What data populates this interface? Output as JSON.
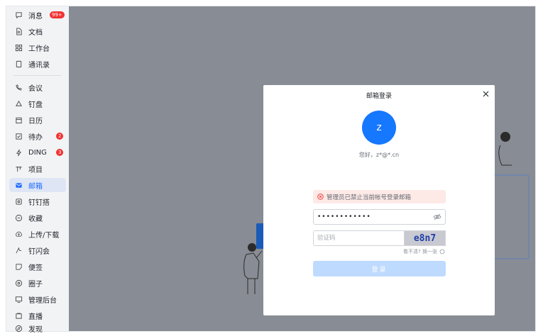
{
  "sidebar": {
    "items": [
      {
        "label": "消息",
        "icon": "chat-bubble-icon",
        "badge": "99+"
      },
      {
        "label": "文档",
        "icon": "document-icon",
        "badge": ""
      },
      {
        "label": "工作台",
        "icon": "grid-icon",
        "badge": ""
      },
      {
        "label": "通讯录",
        "icon": "contacts-icon",
        "badge": ""
      },
      {
        "label": "会议",
        "icon": "video-icon",
        "badge": ""
      },
      {
        "label": "钉盘",
        "icon": "cloud-drive-icon",
        "badge": ""
      },
      {
        "label": "日历",
        "icon": "calendar-icon",
        "badge": ""
      },
      {
        "label": "待办",
        "icon": "checkbox-icon",
        "badge": "2"
      },
      {
        "label": "DING",
        "icon": "lightning-icon",
        "badge": "3"
      },
      {
        "label": "项目",
        "icon": "project-icon",
        "badge": ""
      },
      {
        "label": "邮箱",
        "icon": "mail-icon",
        "badge": ""
      },
      {
        "label": "钉钉搭",
        "icon": "builder-icon",
        "badge": ""
      },
      {
        "label": "收藏",
        "icon": "favorite-icon",
        "badge": ""
      },
      {
        "label": "上传/下载",
        "icon": "upload-icon",
        "badge": ""
      },
      {
        "label": "钉闪会",
        "icon": "flash-icon",
        "badge": ""
      },
      {
        "label": "便签",
        "icon": "note-icon",
        "badge": ""
      },
      {
        "label": "圈子",
        "icon": "circle-icon",
        "badge": ""
      },
      {
        "label": "管理后台",
        "icon": "monitor-icon",
        "badge": ""
      },
      {
        "label": "直播",
        "icon": "live-icon",
        "badge": ""
      },
      {
        "label": "发现",
        "icon": "discover-icon",
        "badge": ""
      }
    ],
    "active_index": 10
  },
  "modal": {
    "title": "邮箱登录",
    "avatar_letter": "z",
    "greeting": "您好，z*@*.cn",
    "alert_text": "管理员已禁止当前帐号登录邮箱",
    "password_value": "••••••••••••",
    "captcha_placeholder": "验证码",
    "captcha_text": "e8n7",
    "refresh_text": "看不清? 换一张",
    "login_label": "登录"
  },
  "colors": {
    "accent": "#1677ff",
    "badge": "#f23030",
    "overlay": "#888c94",
    "login_disabled": "#bedaff"
  }
}
